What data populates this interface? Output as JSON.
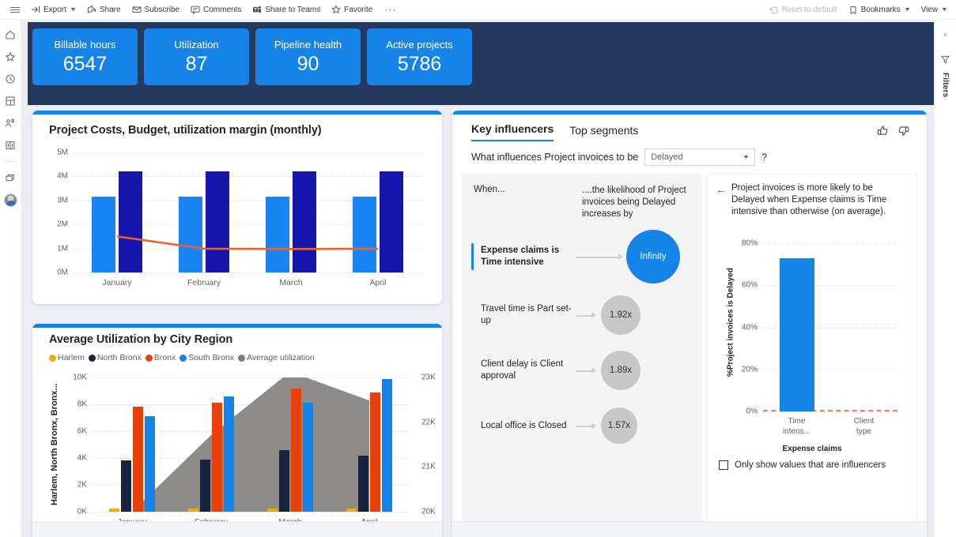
{
  "toolbar": {
    "left_items": [
      {
        "label": "Export",
        "icon": "export-icon",
        "has_chevron": true
      },
      {
        "label": "Share",
        "icon": "share-icon",
        "has_chevron": false
      },
      {
        "label": "Subscribe",
        "icon": "envelope-icon",
        "has_chevron": false
      },
      {
        "label": "Comments",
        "icon": "comment-icon",
        "has_chevron": false
      },
      {
        "label": "Share to Teams",
        "icon": "teams-icon",
        "has_chevron": false
      },
      {
        "label": "Favorite",
        "icon": "star-icon",
        "has_chevron": false
      }
    ],
    "overflow": "···",
    "right_items": [
      {
        "label": "Reset to default",
        "icon": "undo-icon",
        "has_chevron": false,
        "disabled": true
      },
      {
        "label": "Bookmarks",
        "icon": "bookmark-icon",
        "has_chevron": true,
        "disabled": false
      },
      {
        "label": "View",
        "icon": "",
        "has_chevron": true,
        "disabled": false
      }
    ]
  },
  "left_rail": {
    "items": [
      {
        "name": "home-icon"
      },
      {
        "name": "star-icon"
      },
      {
        "name": "clock-icon"
      },
      {
        "name": "apps-icon"
      },
      {
        "name": "shared-with-me-icon"
      },
      {
        "name": "learn-icon"
      },
      {
        "name": "workspaces-icon"
      }
    ]
  },
  "right_rail": {
    "collapse": "‹",
    "filters_label": "Filters"
  },
  "kpis": [
    {
      "title": "Billable hours",
      "value": "6547"
    },
    {
      "title": "Utilization",
      "value": "87"
    },
    {
      "title": "Pipeline health",
      "value": "90"
    },
    {
      "title": "Active projects",
      "value": "5786"
    }
  ],
  "colors": {
    "accent": "#1683e8",
    "navy_band": "#25395e",
    "bar_light_blue": "#1A85F5",
    "bar_navy": "#1616AF",
    "line_orange": "#E8622A",
    "harlem": "#EDAA0B",
    "north_bronx": "#16243F",
    "bronx": "#E8400B",
    "south_bronx": "#1683e8",
    "average_utilization": "#7D7C7A"
  },
  "chart_data": [
    {
      "type": "bar",
      "title": "Project Costs, Budget, utilization margin (monthly)",
      "categories": [
        "January",
        "February",
        "March",
        "April"
      ],
      "series": [
        {
          "name": "Project Costs",
          "type": "bar",
          "color": "#1A85F5",
          "values": [
            3150000,
            3150000,
            3150000,
            3150000
          ]
        },
        {
          "name": "Budget",
          "type": "bar",
          "color": "#1616AF",
          "values": [
            4200000,
            4200000,
            4200000,
            4200000
          ]
        },
        {
          "name": "utilization margin",
          "type": "line",
          "color": "#E8622A",
          "values": [
            1500000,
            990000,
            975000,
            990000
          ]
        }
      ],
      "ylabel": "",
      "xlabel": "",
      "ylim": [
        0,
        5000000
      ],
      "yticks": [
        "0M",
        "1M",
        "2M",
        "3M",
        "4M",
        "5M"
      ],
      "grid": true,
      "legend": "none"
    },
    {
      "type": "bar",
      "title": "Average Utilization by City Region",
      "categories": [
        "January",
        "February",
        "March",
        "April"
      ],
      "series": [
        {
          "name": "Harlem",
          "type": "bar",
          "color": "#EDAA0B",
          "values": [
            250,
            230,
            230,
            230
          ]
        },
        {
          "name": "North Bronx",
          "type": "bar",
          "color": "#16243F",
          "values": [
            3850,
            3900,
            4600,
            4150
          ]
        },
        {
          "name": "Bronx",
          "type": "bar",
          "color": "#E8400B",
          "values": [
            7800,
            8100,
            9200,
            8900
          ]
        },
        {
          "name": "South Bronx",
          "type": "bar",
          "color": "#1683e8",
          "values": [
            7100,
            8600,
            8100,
            9900
          ]
        },
        {
          "name": "Average utilization",
          "type": "area",
          "color": "#7D7C7A",
          "axis": "secondary",
          "values": [
            20000,
            22000,
            23650,
            22900
          ]
        }
      ],
      "ylabel": "Harlem, North Bronx, Bronx...",
      "xlabel": "",
      "ylim": [
        0,
        10000
      ],
      "yticks": [
        "0K",
        "2K",
        "4K",
        "6K",
        "8K",
        "10K"
      ],
      "y2lim": [
        20000,
        23500
      ],
      "y2ticks": [
        "20K",
        "21K",
        "22K",
        "23K"
      ],
      "grid": true,
      "legend": "top"
    },
    {
      "type": "bar",
      "title": "Project invoices is more likely to be Delayed when Expense claims is Time intensive than otherwise (on average).",
      "categories": [
        "Time intens...",
        "Client type"
      ],
      "values": [
        73,
        0
      ],
      "ylabel": "%Project invoices is Delayed",
      "xlabel": "Expense claims",
      "ylim": [
        0,
        85
      ],
      "yticks": [
        "0%",
        "20%",
        "40%",
        "60%",
        "80%"
      ],
      "grid": true,
      "legend": "none",
      "color": "#1683e8"
    }
  ],
  "key_influencers": {
    "tabs": [
      {
        "label": "Key influencers",
        "active": true
      },
      {
        "label": "Top segments",
        "active": false
      }
    ],
    "question_prefix": "What influences Project invoices to be",
    "selected_value": "Delayed",
    "help": "?",
    "column_when": "When...",
    "column_likelihood": "....the likelihood of Project invoices being Delayed increases by",
    "rows": [
      {
        "label": "Expense claims is Time intensive",
        "value": "Infinity",
        "highlighted": true
      },
      {
        "label": "Travel time is Part set-up",
        "value": "1.92x",
        "highlighted": false
      },
      {
        "label": "Client delay is Client approval",
        "value": "1.89x",
        "highlighted": false
      },
      {
        "label": "Local office is Closed",
        "value": "1.57x",
        "highlighted": false
      }
    ],
    "detail": {
      "back": "←",
      "text": "Project invoices is more likely to be Delayed when Expense claims is Time intensive than otherwise (on average).",
      "ylabel": "%Project invoices is Delayed",
      "xaxis_title": "Expense claims",
      "categories": [
        "Time intens...",
        "Client type"
      ],
      "yticks": [
        "80%",
        "60%",
        "40%",
        "20%",
        "0%"
      ],
      "checkbox_label": "Only show values that are influencers",
      "checkbox_checked": false
    }
  }
}
